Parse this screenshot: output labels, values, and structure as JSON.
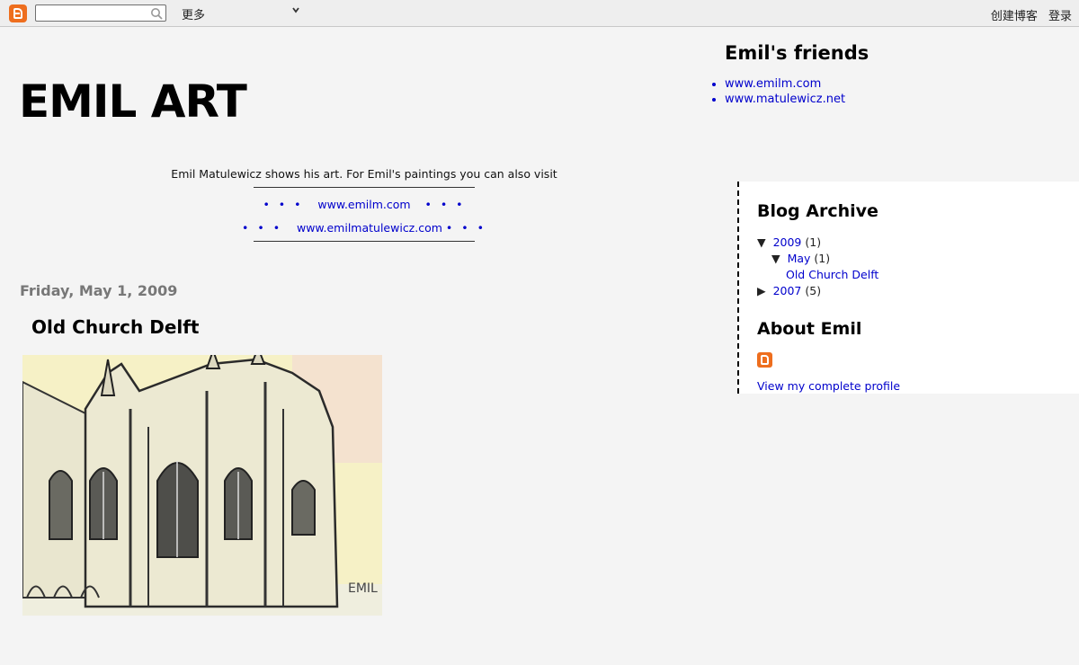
{
  "navbar": {
    "more_label": "更多",
    "create_blog": "创建博客",
    "sign_in": "登录"
  },
  "header": {
    "title": "EMIL ART",
    "description": "Emil Matulewicz shows his art. For Emil's paintings you can also visit",
    "link1": "www.emilm.com",
    "link2": "www.emilmatulewicz.com"
  },
  "post": {
    "date": "Friday, May 1, 2009",
    "title": "Old Church Delft",
    "image_signature": "EMIL"
  },
  "friends": {
    "title": "Emil's friends",
    "links": [
      "www.emilm.com",
      "www.matulewicz.net"
    ]
  },
  "archive": {
    "title": "Blog Archive",
    "year_2009": "2009",
    "year_2009_count": "(1)",
    "month_may": "May",
    "month_may_count": "(1)",
    "post_link": "Old Church Delft",
    "year_2007": "2007",
    "year_2007_count": "(5)"
  },
  "about": {
    "title": "About Emil",
    "profile_link": "View my complete profile"
  },
  "colors": {
    "link": "#0000cc",
    "blogger_orange": "#ee6e1e"
  }
}
